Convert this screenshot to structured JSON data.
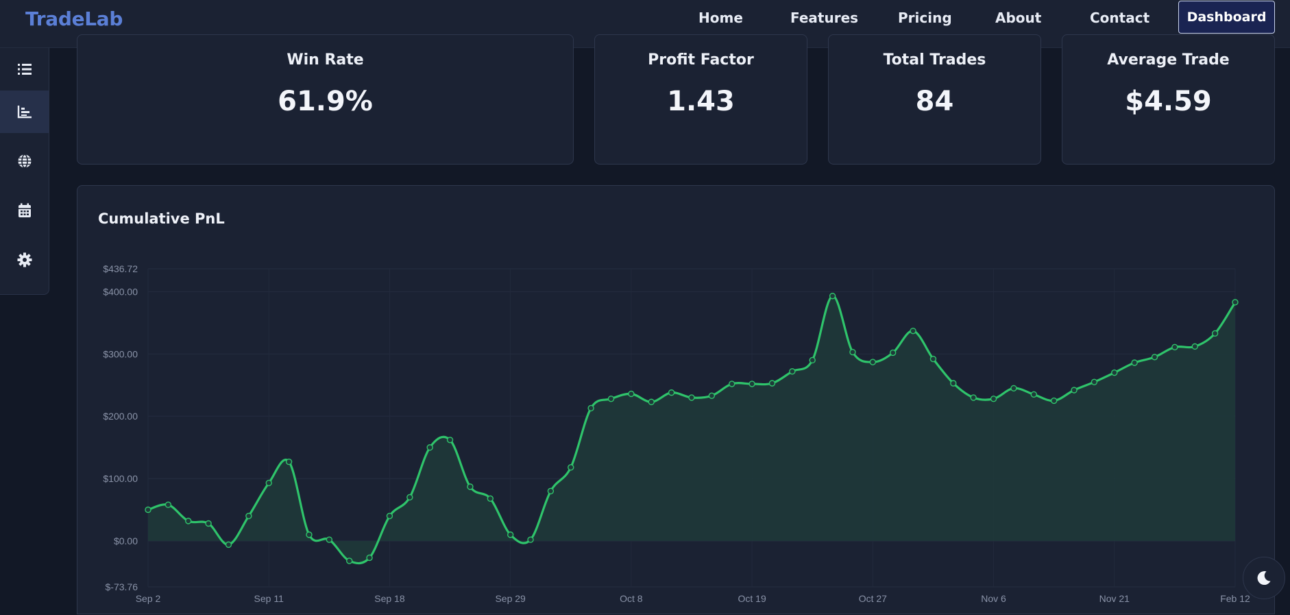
{
  "brand": "TradeLab",
  "nav": {
    "home": "Home",
    "features": "Features",
    "pricing": "Pricing",
    "about": "About",
    "contact": "Contact",
    "dashboard": "Dashboard"
  },
  "sidebar": {
    "items": [
      {
        "icon": "list-icon"
      },
      {
        "icon": "bar-chart-icon",
        "active": true
      },
      {
        "icon": "globe-icon"
      },
      {
        "icon": "calendar-icon"
      },
      {
        "icon": "gear-icon"
      }
    ]
  },
  "stats": [
    {
      "label": "Win Rate",
      "value": "61.9%"
    },
    {
      "label": "Profit Factor",
      "value": "1.43"
    },
    {
      "label": "Total Trades",
      "value": "84"
    },
    {
      "label": "Average Trade",
      "value": "$4.59"
    }
  ],
  "chart": {
    "title": "Cumulative PnL",
    "line_color": "#2fc46b",
    "fill_color": "#1f3a3a"
  },
  "chart_data": {
    "type": "area",
    "title": "Cumulative PnL",
    "ylim": [
      -73.76,
      436.72
    ],
    "y_ticks": [
      "$436.72",
      "$400.00",
      "$300.00",
      "$200.00",
      "$100.00",
      "$0.00",
      "$-73.76"
    ],
    "y_tick_values": [
      436.72,
      400,
      300,
      200,
      100,
      0,
      -73.76
    ],
    "x_tick_labels": [
      "Sep 2",
      "Sep 11",
      "Sep 18",
      "Sep 29",
      "Oct 8",
      "Oct 19",
      "Oct 27",
      "Nov 6",
      "Nov 21",
      "Feb 12"
    ],
    "x_tick_indices": [
      0,
      6,
      12,
      18,
      24,
      30,
      36,
      42,
      48,
      54
    ],
    "values": [
      50,
      58,
      32,
      28,
      -6,
      40,
      93,
      127,
      10,
      2,
      -32,
      -27,
      40,
      70,
      150,
      162,
      87,
      68,
      10,
      2,
      80,
      118,
      213,
      228,
      236,
      223,
      238,
      230,
      233,
      252,
      252,
      253,
      272,
      290,
      393,
      303,
      287,
      302,
      337,
      292,
      253,
      230,
      228,
      245,
      235,
      225,
      242,
      255,
      270,
      286,
      295,
      311,
      312,
      333,
      383
    ],
    "grid": true,
    "legend": "none"
  },
  "theme_toggle_icon": "moon-icon"
}
